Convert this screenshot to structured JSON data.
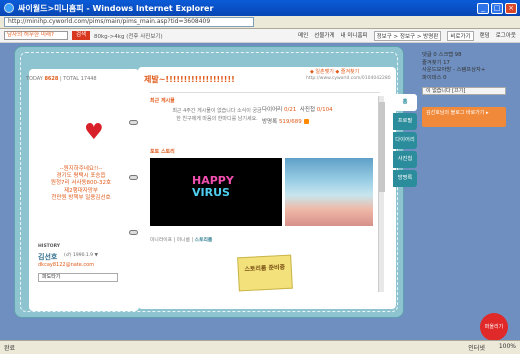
{
  "window": {
    "title": "싸이월드>미니홈피 - Windows Internet Explorer",
    "url": "http://minihp.cyworld.com/pims/main/pims_main.asp?tid=3608409"
  },
  "topbar": {
    "search_placeholder": "남자의 허무한 미래?",
    "search_button": "검색",
    "promo": "80kg->4kg (전후 사진보기)",
    "links": [
      "메인",
      "선물가게",
      "내 미니홈피",
      "정보구 > 정보구 > 방명판",
      "비로가기",
      "랜덤",
      "로그아웃"
    ]
  },
  "left": {
    "today_label": "TODAY",
    "today": "8628",
    "total_label": "TOTAL",
    "total": "17448",
    "notice": [
      "--원지하주네요!!--",
      "경기도 평택시 포승읍",
      "원정7리 서사동800-32호",
      "제2행대자망부",
      "천만원 방책부 일용김선호"
    ],
    "history": "HISTORY",
    "name": "김선호",
    "meta": "(♂) 1990.1.9 ▼",
    "email": "dkcay8122@nate.com",
    "pado": "파도타기"
  },
  "right": {
    "title": "제발~!!!!!!!!!!!!!!!!!!!",
    "links": "◆ 일촌맺기 ◆ 즐겨찾기",
    "url": "http://www.cyworld.com/0104042280",
    "recent_label": "최근 게시물",
    "recent_text": "최근 4주간 게시물이 없습니다 소식이 궁금한 친구에게 마음의 한마디를 남기세요.",
    "counts": [
      {
        "label": "다이어리",
        "val": "0/21",
        "label2": "사진첩",
        "val2": "0/104"
      },
      {
        "label": "방명록",
        "val": "519/689"
      }
    ],
    "story_label": "포토 스토리",
    "happy": "HAPPY VIRUS",
    "tabs": [
      "미니라이프",
      "미니룸",
      "스토리룸"
    ],
    "sticky": "스토리룸 준비중"
  },
  "menu": [
    "홈",
    "프로필",
    "다이어리",
    "사진첩",
    "방명록"
  ],
  "panel": {
    "lines": [
      "댓글 0  스크랩 98",
      "즐겨찾기 17",
      "사운드모아방 - 스탬프상자+",
      "파이데스 0"
    ],
    "weather": "이 없습니다    [끄기]",
    "promo": "김선호님의 블로그 바로가기 ▸"
  },
  "share": "퍼올리기",
  "status": {
    "done": "완료",
    "zone": "인터넷",
    "zoom": "100%"
  }
}
